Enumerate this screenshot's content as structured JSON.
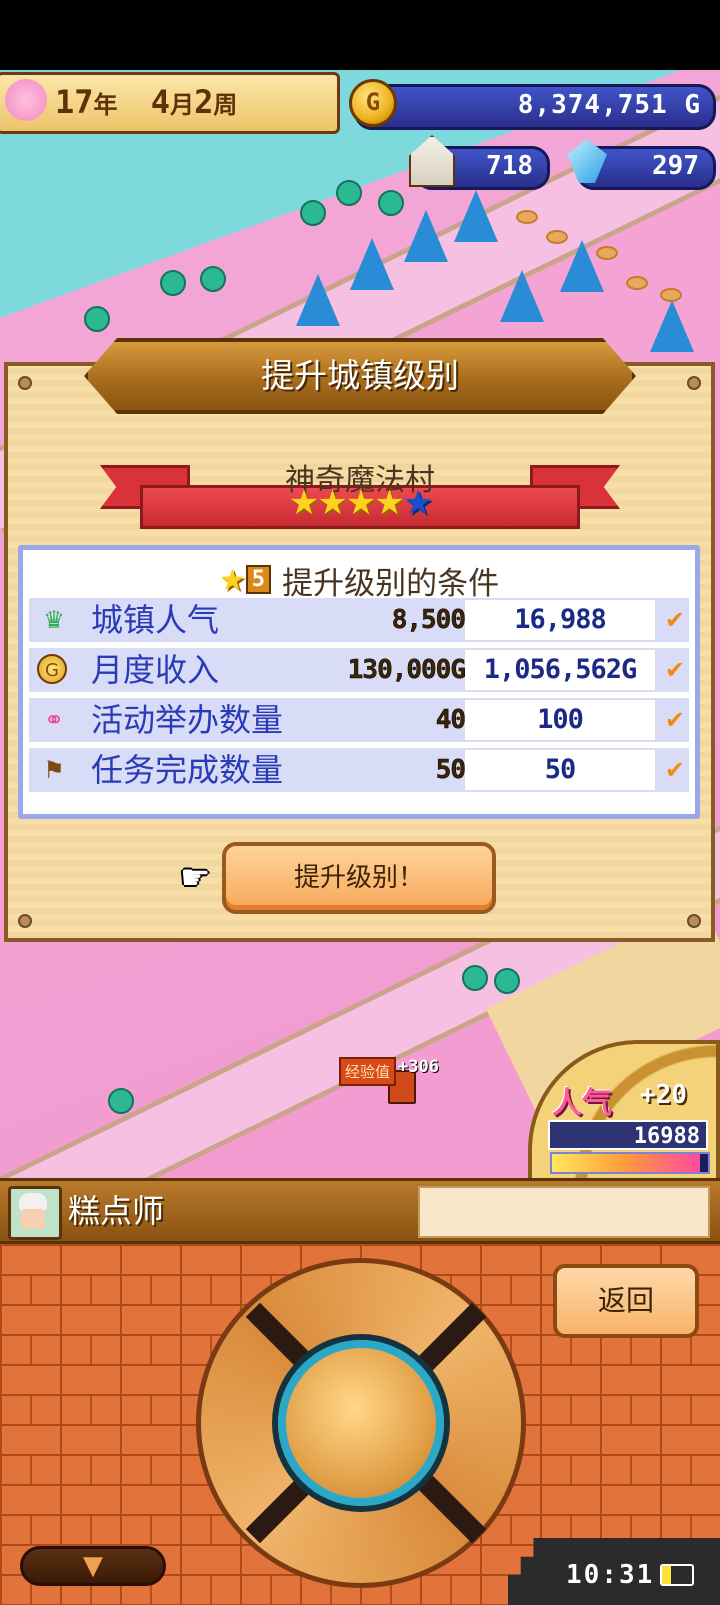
{
  "hud": {
    "year": "17",
    "year_unit": "年",
    "month": "4",
    "month_unit": "月",
    "week": "2",
    "week_unit": "周",
    "gold": "8,374,751",
    "gold_unit": "G",
    "houses": "718",
    "crystals": "297"
  },
  "dialog": {
    "title": "提升城镇级别",
    "town_name": "神奇魔法村",
    "stars_filled": 4,
    "stars_total": 5,
    "conditions_level": "5",
    "conditions_title": "提升级别的条件",
    "rows": [
      {
        "icon": "popularity-icon",
        "label": "城镇人气",
        "required": "8,500",
        "current": "16,988",
        "met": "✔"
      },
      {
        "icon": "gold-coin-icon",
        "label": "月度收入",
        "required": "130,000G",
        "current": "1,056,562G",
        "met": "✔"
      },
      {
        "icon": "balloons-icon",
        "label": "活动举办数量",
        "required": "40",
        "current": "100",
        "met": "✔"
      },
      {
        "icon": "quest-flag-icon",
        "label": "任务完成数量",
        "required": "50",
        "current": "50",
        "met": "✔"
      }
    ],
    "level_up_button": "提升级别！"
  },
  "world": {
    "exp_label": "经验值",
    "exp_value": "+306"
  },
  "popularity": {
    "label": "人气",
    "delta": "+20",
    "value": "16988",
    "gauge_fill": 0.95
  },
  "info_bar": {
    "character_name": "糕点师",
    "message": ""
  },
  "controls": {
    "back_button": "返回",
    "menu_toggle": "▼"
  },
  "status": {
    "clock": "10:31",
    "battery_level": 0.3
  },
  "colors": {
    "accent_blue": "#2a3bb8",
    "check_orange": "#f08a12",
    "ribbon_red": "#d9323a"
  }
}
